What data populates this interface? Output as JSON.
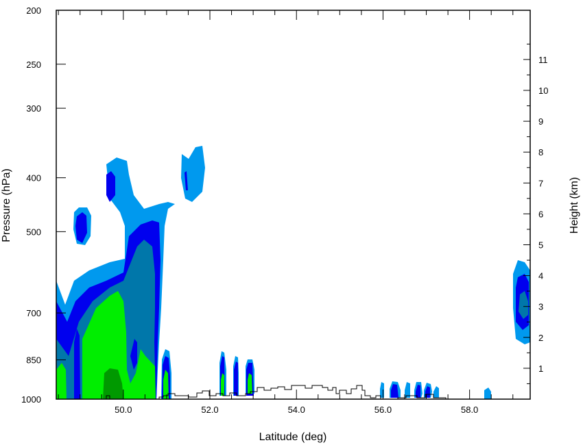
{
  "chart_data": {
    "type": "contour-cross-section",
    "title": "",
    "xlabel": "Latitude (deg)",
    "ylabel_left": "Pressure (hPa)",
    "ylabel_right": "Height (km)",
    "xlim": [
      48.45,
      59.4
    ],
    "ylim": [
      1000,
      200
    ],
    "y_scale": "log",
    "x_ticks": [
      {
        "value": 50,
        "label": "50.0"
      },
      {
        "value": 52,
        "label": "52.0"
      },
      {
        "value": 54,
        "label": "54.0"
      },
      {
        "value": 56,
        "label": "56.0"
      },
      {
        "value": 58,
        "label": "58.0"
      }
    ],
    "y_ticks_left": [
      {
        "value": 200,
        "label": "200"
      },
      {
        "value": 250,
        "label": "250"
      },
      {
        "value": 300,
        "label": "300"
      },
      {
        "value": 400,
        "label": "400"
      },
      {
        "value": 500,
        "label": "500"
      },
      {
        "value": 700,
        "label": "700"
      },
      {
        "value": 850,
        "label": "850"
      },
      {
        "value": 1000,
        "label": "1000"
      }
    ],
    "y_ticks_right": [
      {
        "value": 1,
        "label": "1"
      },
      {
        "value": 2,
        "label": "2"
      },
      {
        "value": 3,
        "label": "3"
      },
      {
        "value": 4,
        "label": "4"
      },
      {
        "value": 5,
        "label": "5"
      },
      {
        "value": 6,
        "label": "6"
      },
      {
        "value": 7,
        "label": "7"
      },
      {
        "value": 8,
        "label": "8"
      },
      {
        "value": 9,
        "label": "9"
      },
      {
        "value": 10,
        "label": "10"
      },
      {
        "value": 11,
        "label": "11"
      }
    ],
    "contour_colors": [
      "#0099ee",
      "#0000ee",
      "#0077aa",
      "#00ee00",
      "#009900"
    ],
    "grid": false,
    "legend": "none"
  }
}
